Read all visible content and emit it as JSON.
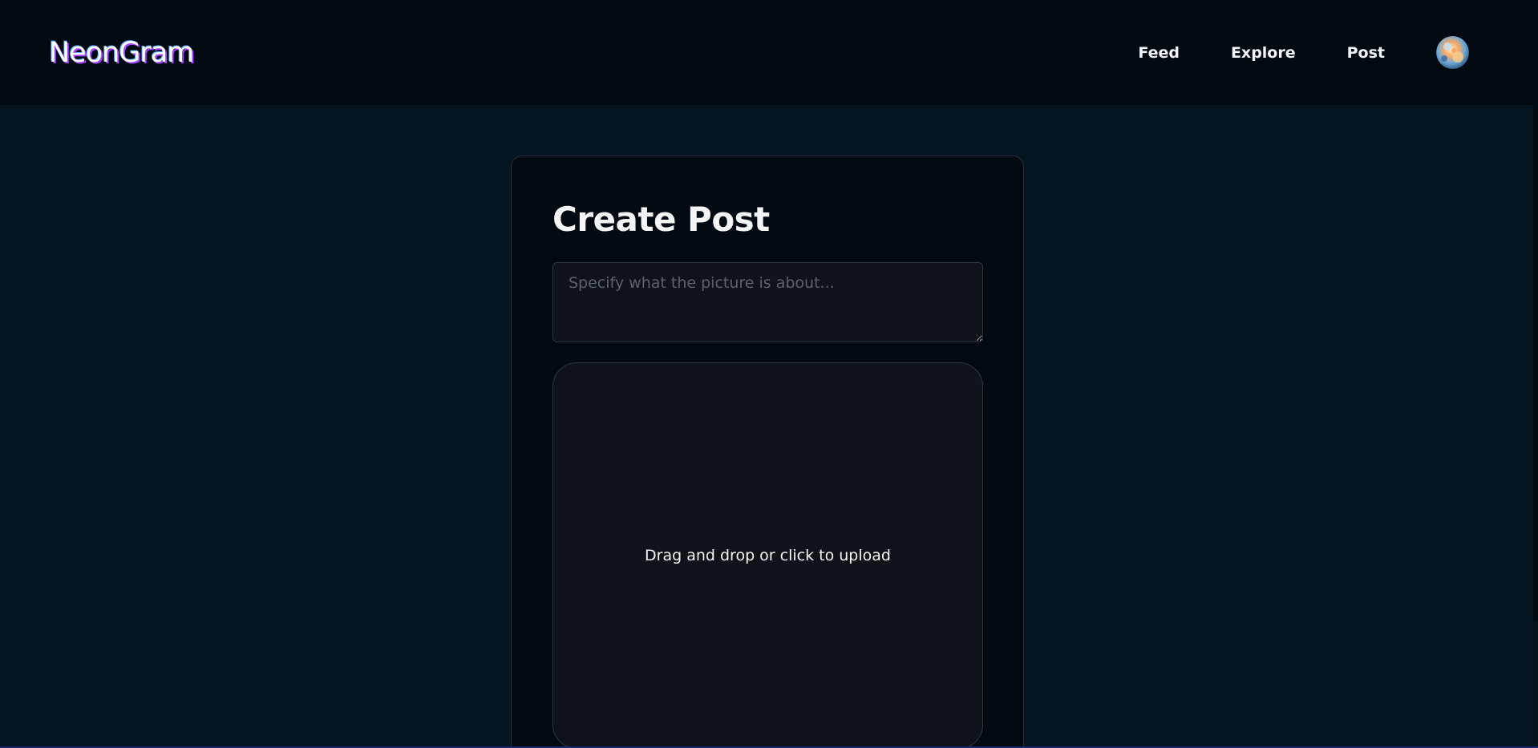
{
  "header": {
    "brand": "NeonGram",
    "nav": [
      {
        "label": "Feed"
      },
      {
        "label": "Explore"
      },
      {
        "label": "Post"
      }
    ],
    "avatar_icon": "user-avatar-icon"
  },
  "form": {
    "title": "Create Post",
    "caption_placeholder": "Specify what the picture is about...",
    "caption_value": "",
    "upload_label": "Drag and drop or click to upload"
  },
  "colors": {
    "background": "#061420",
    "header_bg": "#010911",
    "card_bg": "#010911",
    "input_bg": "#0d1318",
    "border": "#30363d",
    "brand_glow": "#a445ff"
  }
}
